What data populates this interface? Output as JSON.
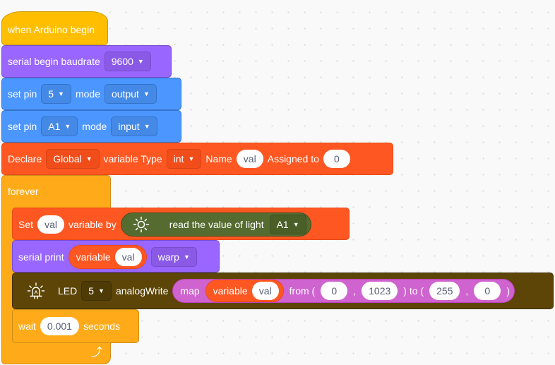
{
  "hat": {
    "label": "when Arduino begin"
  },
  "serial_begin": {
    "label": "serial begin baudrate",
    "baud": "9600"
  },
  "pin_mode_1": {
    "label": "set pin",
    "pin": "5",
    "mode_label": "mode",
    "mode": "output"
  },
  "pin_mode_2": {
    "label": "set pin",
    "pin": "A1",
    "mode_label": "mode",
    "mode": "input"
  },
  "declare": {
    "label": "Declare",
    "scope": "Global",
    "type_label": "variable Type",
    "type": "int",
    "name_label": "Name",
    "name": "val",
    "assign_label": "Assigned to",
    "value": "0"
  },
  "forever": {
    "label": "forever"
  },
  "set_var": {
    "label": "Set",
    "var": "val",
    "by_label": "variable by",
    "reporter_label": "read the value of light",
    "pin": "A1"
  },
  "serial_print": {
    "label": "serial print",
    "reporter_label": "variable",
    "var": "val",
    "option": "warp"
  },
  "led": {
    "label": "LED",
    "pin": "5",
    "write_label": "analogWrite",
    "map_label": "map",
    "var_label": "variable",
    "var": "val",
    "from_label": "from (",
    "from_low": "0",
    "comma1": ",",
    "from_high": "1023",
    "to_label": ") to (",
    "to_low": "255",
    "comma2": ",",
    "to_high": "0",
    "close": ")"
  },
  "wait": {
    "label": "wait",
    "value": "0.001",
    "unit": "seconds"
  },
  "icons": {
    "dropdown": "▼",
    "loop_arrow": "loop-arrow-icon",
    "light": "sun-icon",
    "led": "led-icon"
  },
  "colors": {
    "events": "#ffbf00",
    "serial": "#9966ff",
    "pins": "#4c97ff",
    "variables": "#ff5722",
    "control": "#ffab19",
    "light": "#556b2f",
    "led": "#5c4506",
    "operators": "#cf63cf"
  }
}
